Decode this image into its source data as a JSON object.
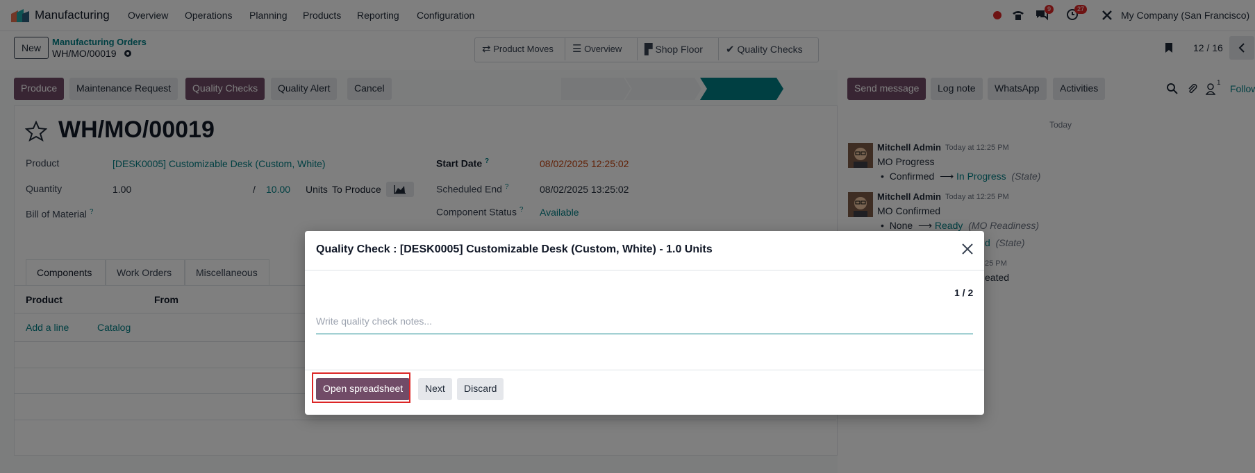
{
  "navbar": {
    "app_name": "Manufacturing",
    "menu": [
      "Overview",
      "Operations",
      "Planning",
      "Products",
      "Reporting",
      "Configuration"
    ],
    "messages_badge": "9",
    "activities_badge": "27",
    "company": "My Company (San Francisco)"
  },
  "control_panel": {
    "new_label": "New",
    "breadcrumb_parent": "Manufacturing Orders",
    "breadcrumb_current": "WH/MO/00019",
    "smart_buttons": [
      "Product Moves",
      "Overview",
      "Shop Floor",
      "Quality Checks"
    ],
    "pager": "12 / 16"
  },
  "actions": {
    "produce": "Produce",
    "maintenance": "Maintenance Request",
    "quality_checks": "Quality Checks",
    "quality_alert": "Quality Alert",
    "cancel": "Cancel"
  },
  "form": {
    "title": "WH/MO/00019",
    "product_label": "Product",
    "product_value": "[DESK0005] Customizable Desk (Custom, White)",
    "quantity_label": "Quantity",
    "quantity_value": "1.00",
    "quantity_sep": "/",
    "quantity_target": "10.00",
    "quantity_unit": "Units",
    "quantity_suffix": "To Produce",
    "bom_label": "Bill of Material",
    "start_date_label": "Start Date",
    "start_date_value": "08/02/2025 12:25:02",
    "scheduled_end_label": "Scheduled End",
    "scheduled_end_value": "08/02/2025 13:25:02",
    "component_status_label": "Component Status",
    "component_status_value": "Available",
    "help_mark": "?",
    "tabs": [
      "Components",
      "Work Orders",
      "Miscellaneous"
    ],
    "columns": [
      "Product",
      "From"
    ],
    "add_line": "Add a line",
    "catalog": "Catalog"
  },
  "chatter": {
    "send_message": "Send message",
    "log_note": "Log note",
    "whatsapp": "WhatsApp",
    "activities": "Activities",
    "followers_count": "1",
    "follow": "Follow",
    "date_sep": "Today",
    "messages": [
      {
        "author": "Mitchell Admin",
        "time": "Today at 12:25 PM",
        "title": "MO Progress",
        "old": "Confirmed",
        "new": "In Progress",
        "field": "(State)"
      },
      {
        "author": "Mitchell Admin",
        "time": "Today at 12:25 PM",
        "title": "MO Confirmed",
        "old": "None",
        "new": "Ready",
        "field": "(MO Readiness)",
        "partial2_new": "d",
        "partial2_field": "(State)"
      }
    ],
    "partial_time": "25 PM",
    "partial_text": "eated"
  },
  "modal": {
    "title": "Quality Check : [DESK0005] Customizable Desk (Custom, White) - 1.0 Units",
    "counter": "1 / 2",
    "notes_placeholder": "Write quality check notes...",
    "open_spreadsheet": "Open spreadsheet",
    "next": "Next",
    "discard": "Discard"
  },
  "colors": {
    "primary": "#714B67",
    "link": "#017e84",
    "date_warning": "#c2410c",
    "badge": "#dc2626"
  }
}
